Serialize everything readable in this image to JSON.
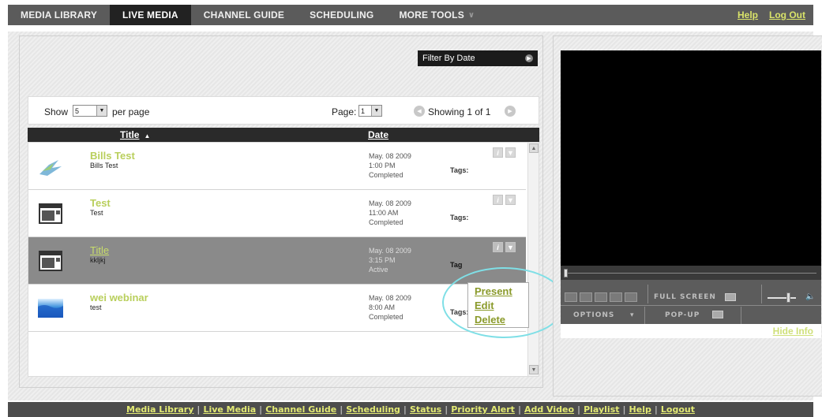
{
  "nav": {
    "tabs": [
      {
        "label": "MEDIA LIBRARY",
        "active": false
      },
      {
        "label": "LIVE MEDIA",
        "active": true
      },
      {
        "label": "CHANNEL GUIDE",
        "active": false
      },
      {
        "label": "SCHEDULING",
        "active": false
      },
      {
        "label": "MORE TOOLS",
        "active": false
      }
    ],
    "help": "Help",
    "logout": "Log Out"
  },
  "filter": {
    "label": "Filter By Date"
  },
  "list": {
    "show_label": "Show",
    "per_page_value": "5",
    "per_page_label": "per page",
    "page_label": "Page:",
    "page_value": "1",
    "showing": "Showing 1 of 1",
    "columns": {
      "title": "Title",
      "date": "Date"
    },
    "rows": [
      {
        "title": "Bills Test",
        "subtitle": "Bills Test",
        "date": "May. 08 2009",
        "time": "1:00 PM",
        "status": "Completed",
        "tags_label": "Tags:",
        "thumb": "bird-icon",
        "active": false
      },
      {
        "title": "Test",
        "subtitle": "Test",
        "date": "May. 08 2009",
        "time": "11:00 AM",
        "status": "Completed",
        "tags_label": "Tags:",
        "thumb": "window-icon",
        "active": false
      },
      {
        "title": "Title",
        "subtitle": "kkljkj",
        "date": "May. 08 2009",
        "time": "3:15 PM",
        "status": "Active",
        "tags_label": "Tag",
        "thumb": "window-icon",
        "active": true
      },
      {
        "title": "wei webinar",
        "subtitle": "test",
        "date": "May. 08 2009",
        "time": "8:00 AM",
        "status": "Completed",
        "tags_label": "Tags:",
        "thumb": "wave-image",
        "active": false
      }
    ]
  },
  "context_menu": {
    "items": [
      "Present",
      "Edit",
      "Delete"
    ]
  },
  "player": {
    "fullscreen_label": "FULL SCREEN",
    "options_label": "OPTIONS",
    "popup_label": "POP-UP",
    "hide_info": "Hide Info"
  },
  "footer": {
    "links": [
      "Media Library",
      "Live Media",
      "Channel Guide",
      "Scheduling",
      "Status",
      "Priority Alert",
      "Add Video",
      "Playlist",
      "Help",
      "Logout"
    ]
  },
  "colors": {
    "accent": "#b9cf5c",
    "nav_bg": "#5b5b5b",
    "highlight": "#7fdfe6"
  }
}
